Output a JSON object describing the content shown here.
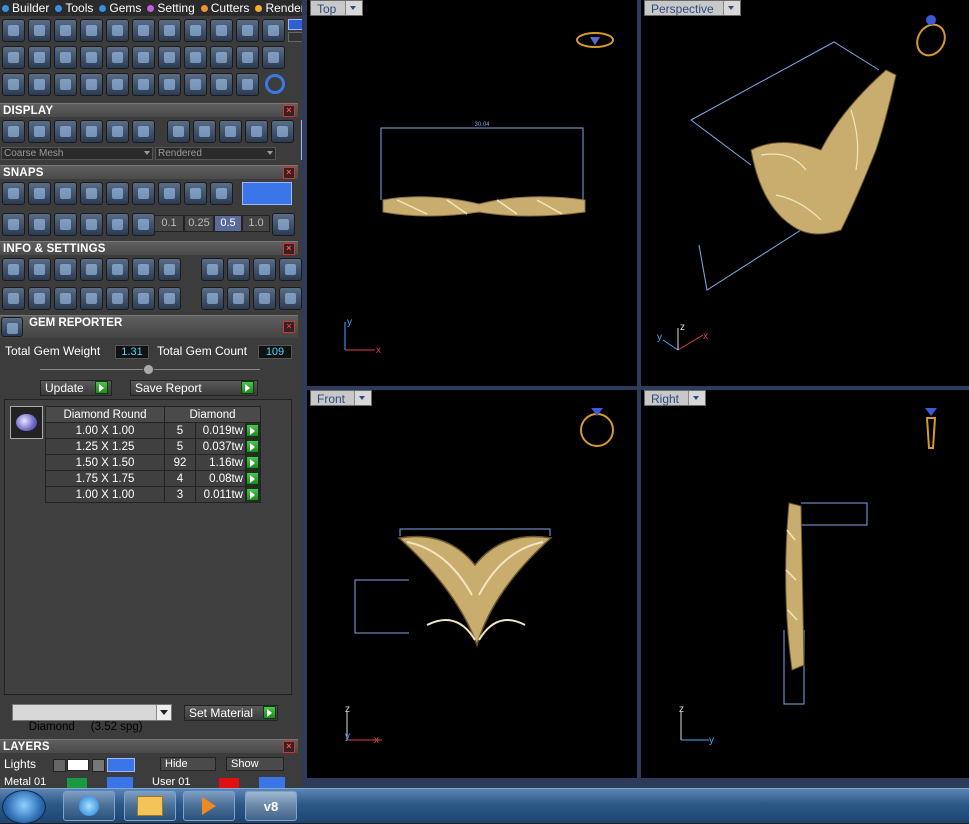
{
  "menubar": {
    "items": [
      {
        "label": "Builder",
        "color": "#3b8ee8"
      },
      {
        "label": "Tools",
        "color": "#3b8ee8"
      },
      {
        "label": "Gems",
        "color": "#3b8ee8"
      },
      {
        "label": "Setting",
        "color": "#c060e0"
      },
      {
        "label": "Cutters",
        "color": "#f09030"
      },
      {
        "label": "Render",
        "color": "#f0b030"
      }
    ]
  },
  "display": {
    "header": "DISPLAY",
    "mesh_mode": "Coarse Mesh",
    "render_mode": "Rendered"
  },
  "snaps": {
    "header": "SNAPS",
    "values": [
      "0.1",
      "0.25",
      "0.5",
      "1.0"
    ]
  },
  "info_settings": {
    "header": "INFO & SETTINGS"
  },
  "gem_reporter": {
    "title": "GEM REPORTER",
    "total_weight_label": "Total Gem Weight",
    "total_weight_value": "1.31",
    "total_count_label": "Total Gem Count",
    "total_count_value": "109",
    "update_label": "Update",
    "save_report_label": "Save Report",
    "table": {
      "col_shape": "Diamond Round",
      "col_material": "Diamond",
      "rows": [
        {
          "size": "1.00 X 1.00",
          "count": "5",
          "weight": "0.019tw"
        },
        {
          "size": "1.25 X 1.25",
          "count": "5",
          "weight": "0.037tw"
        },
        {
          "size": "1.50 X 1.50",
          "count": "92",
          "weight": "1.16tw"
        },
        {
          "size": "1.75 X 1.75",
          "count": "4",
          "weight": "0.08tw"
        },
        {
          "size": "1.00 X 1.00",
          "count": "3",
          "weight": "0.011tw"
        }
      ]
    },
    "material_select": "Diamond     (3.52 spg)",
    "set_material_label": "Set Material"
  },
  "layers": {
    "header": "LAYERS",
    "lights_label": "Lights",
    "hide_label": "Hide",
    "show_label": "Show",
    "metal_label": "Metal 01",
    "user_label": "User 01"
  },
  "viewports": {
    "top": {
      "label": "Top",
      "dimension": "30.04"
    },
    "perspective": {
      "label": "Perspective"
    },
    "front": {
      "label": "Front"
    },
    "right": {
      "label": "Right"
    },
    "axes": {
      "x": "x",
      "y": "y",
      "z": "z"
    }
  },
  "taskbar": {
    "apps": [
      "e",
      "folder",
      "play",
      "v8"
    ],
    "v8_label": "v8"
  },
  "colors": {
    "gold": "#c9ad6e",
    "dimension_line": "#7ea9e6",
    "axis_x": "#e04040",
    "axis_y": "#4aa8ff",
    "axis_z": "#dcdcdc",
    "accent_blue": "#4ad6ff"
  }
}
